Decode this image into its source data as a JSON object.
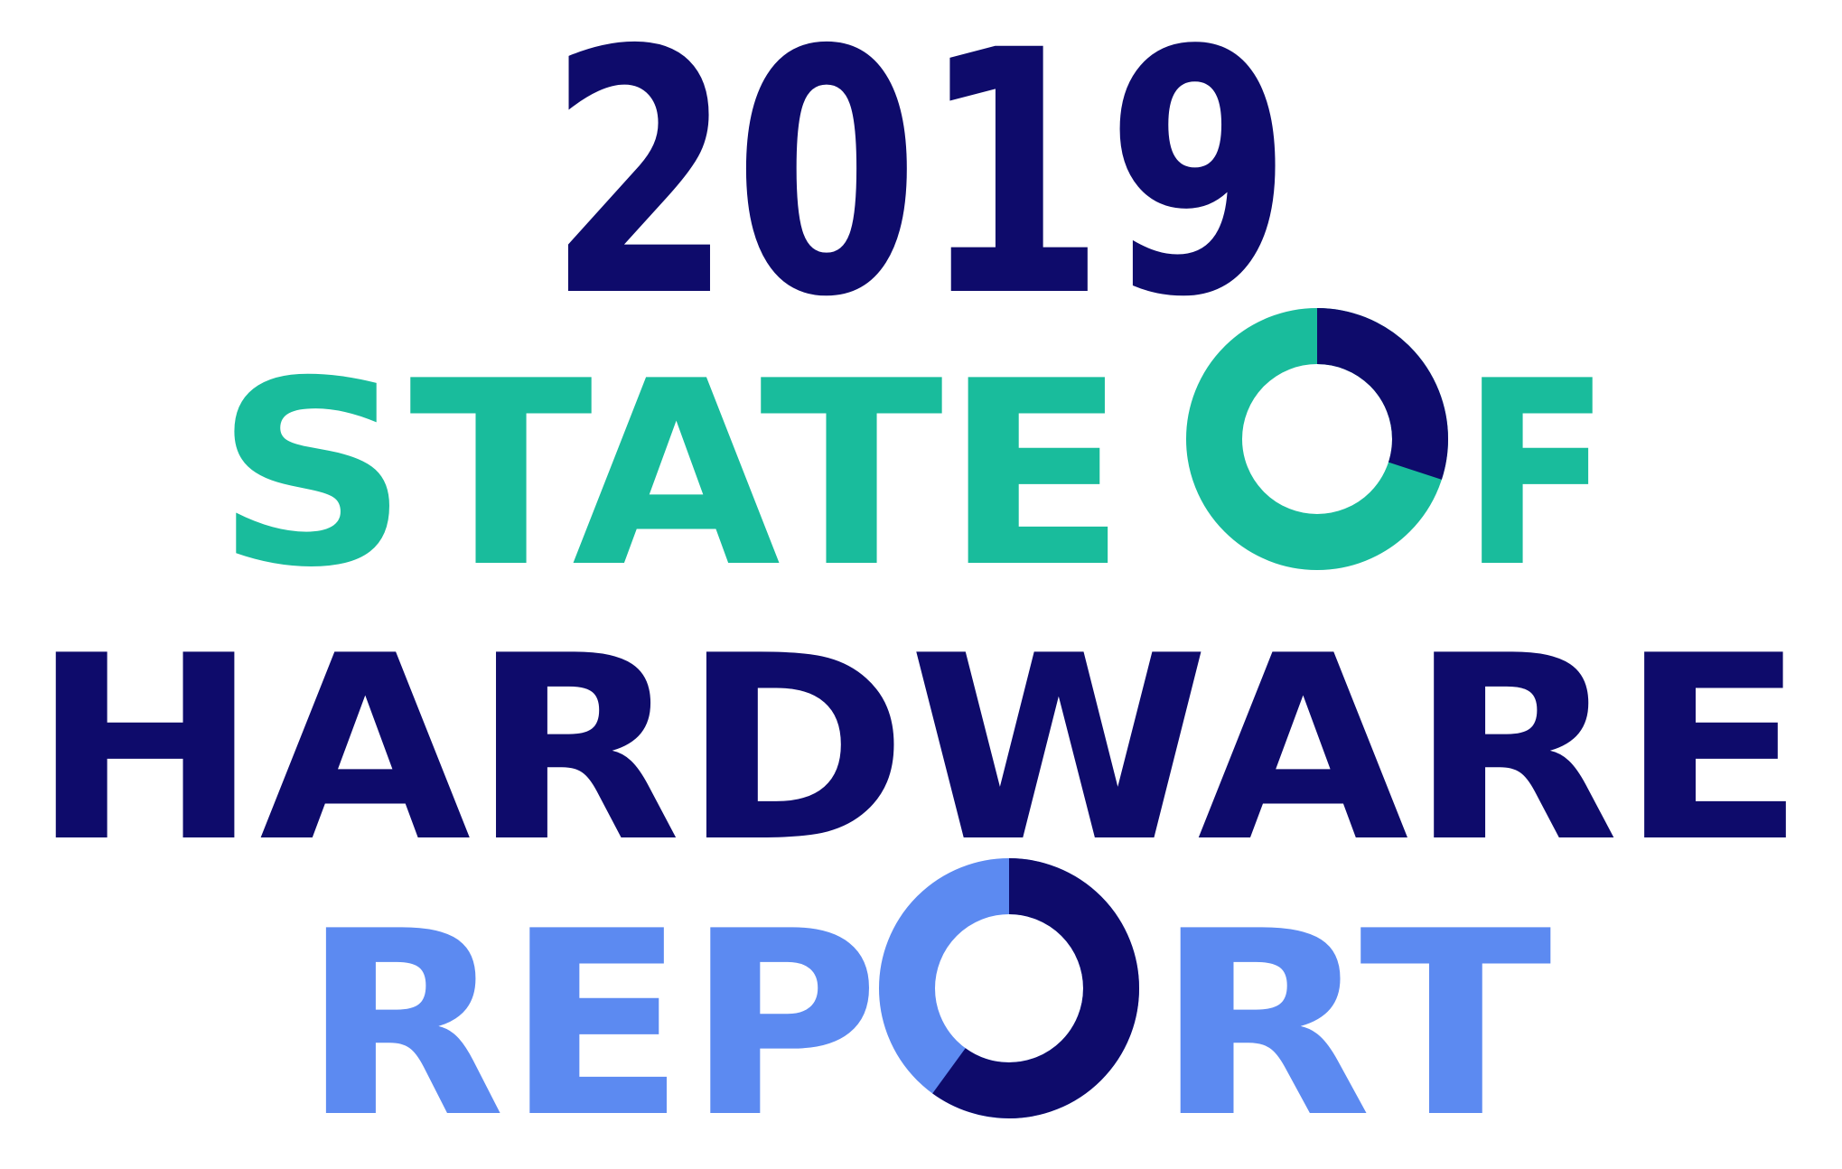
{
  "logo": {
    "line1": "2019",
    "line2_part1": "STATE",
    "line2_o": "O",
    "line2_part2": "F",
    "line3": "HARDWARE",
    "line4_part1": "REP",
    "line4_o": "O",
    "line4_part2": "RT",
    "full_title": "2019 STATE OF HARDWARE REPORT"
  },
  "colors": {
    "navy": "#0e0b6b",
    "teal": "#19bc9c",
    "blue": "#5c8af1",
    "background": "#ffffff"
  },
  "donuts": {
    "state_of_o": {
      "highlight_fraction": 0.3,
      "ring_color": "teal",
      "highlight_color": "navy"
    },
    "report_o": {
      "highlight_fraction": 0.6,
      "ring_color": "blue",
      "highlight_color": "navy"
    }
  }
}
